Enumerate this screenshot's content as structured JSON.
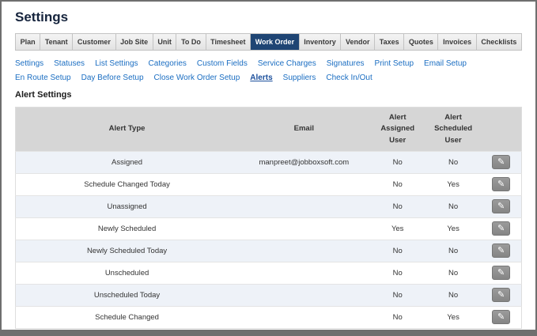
{
  "page": {
    "title": "Settings"
  },
  "tabs": {
    "items": [
      {
        "label": "Plan",
        "active": false
      },
      {
        "label": "Tenant",
        "active": false
      },
      {
        "label": "Customer",
        "active": false
      },
      {
        "label": "Job Site",
        "active": false
      },
      {
        "label": "Unit",
        "active": false
      },
      {
        "label": "To Do",
        "active": false
      },
      {
        "label": "Timesheet",
        "active": false
      },
      {
        "label": "Work Order",
        "active": true
      },
      {
        "label": "Inventory",
        "active": false
      },
      {
        "label": "Vendor",
        "active": false
      },
      {
        "label": "Taxes",
        "active": false
      },
      {
        "label": "Quotes",
        "active": false
      },
      {
        "label": "Invoices",
        "active": false
      },
      {
        "label": "Checklists",
        "active": false
      }
    ]
  },
  "subnav": {
    "items": [
      {
        "label": "Settings",
        "active": false
      },
      {
        "label": "Statuses",
        "active": false
      },
      {
        "label": "List Settings",
        "active": false
      },
      {
        "label": "Categories",
        "active": false
      },
      {
        "label": "Custom Fields",
        "active": false
      },
      {
        "label": "Service Charges",
        "active": false
      },
      {
        "label": "Signatures",
        "active": false
      },
      {
        "label": "Print Setup",
        "active": false
      },
      {
        "label": "Email Setup",
        "active": false
      },
      {
        "label": "En Route Setup",
        "active": false
      },
      {
        "label": "Day Before Setup",
        "active": false
      },
      {
        "label": "Close Work Order Setup",
        "active": false
      },
      {
        "label": "Alerts",
        "active": true
      },
      {
        "label": "Suppliers",
        "active": false
      },
      {
        "label": "Check In/Out",
        "active": false
      }
    ]
  },
  "section": {
    "heading": "Alert Settings"
  },
  "table": {
    "headers": [
      "Alert Type",
      "Email",
      "Alert Assigned User",
      "Alert Scheduled User",
      ""
    ],
    "rows": [
      {
        "alert_type": "Assigned",
        "email": "manpreet@jobboxsoft.com",
        "assigned": "No",
        "scheduled": "No"
      },
      {
        "alert_type": "Schedule Changed Today",
        "email": "",
        "assigned": "No",
        "scheduled": "Yes"
      },
      {
        "alert_type": "Unassigned",
        "email": "",
        "assigned": "No",
        "scheduled": "No"
      },
      {
        "alert_type": "Newly Scheduled",
        "email": "",
        "assigned": "Yes",
        "scheduled": "Yes"
      },
      {
        "alert_type": "Newly Scheduled Today",
        "email": "",
        "assigned": "No",
        "scheduled": "No"
      },
      {
        "alert_type": "Unscheduled",
        "email": "",
        "assigned": "No",
        "scheduled": "No"
      },
      {
        "alert_type": "Unscheduled Today",
        "email": "",
        "assigned": "No",
        "scheduled": "No"
      },
      {
        "alert_type": "Schedule Changed",
        "email": "",
        "assigned": "No",
        "scheduled": "Yes"
      }
    ]
  },
  "icons": {
    "edit": "✎"
  },
  "colors": {
    "active_tab": "#1f4574",
    "link": "#1b6ec2",
    "active_link": "#1b4f9c",
    "table_header_bg": "#d6d6d6",
    "row_alt_bg": "#eef2f8",
    "title_text": "#16243d"
  }
}
